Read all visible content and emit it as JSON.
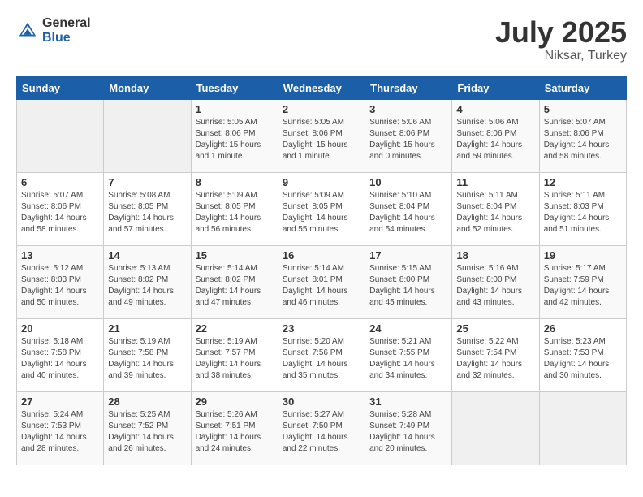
{
  "header": {
    "logo_general": "General",
    "logo_blue": "Blue",
    "month_year": "July 2025",
    "location": "Niksar, Turkey"
  },
  "days_of_week": [
    "Sunday",
    "Monday",
    "Tuesday",
    "Wednesday",
    "Thursday",
    "Friday",
    "Saturday"
  ],
  "weeks": [
    [
      {
        "day": "",
        "sunrise": "",
        "sunset": "",
        "daylight": ""
      },
      {
        "day": "",
        "sunrise": "",
        "sunset": "",
        "daylight": ""
      },
      {
        "day": "1",
        "sunrise": "Sunrise: 5:05 AM",
        "sunset": "Sunset: 8:06 PM",
        "daylight": "Daylight: 15 hours and 1 minute."
      },
      {
        "day": "2",
        "sunrise": "Sunrise: 5:05 AM",
        "sunset": "Sunset: 8:06 PM",
        "daylight": "Daylight: 15 hours and 1 minute."
      },
      {
        "day": "3",
        "sunrise": "Sunrise: 5:06 AM",
        "sunset": "Sunset: 8:06 PM",
        "daylight": "Daylight: 15 hours and 0 minutes."
      },
      {
        "day": "4",
        "sunrise": "Sunrise: 5:06 AM",
        "sunset": "Sunset: 8:06 PM",
        "daylight": "Daylight: 14 hours and 59 minutes."
      },
      {
        "day": "5",
        "sunrise": "Sunrise: 5:07 AM",
        "sunset": "Sunset: 8:06 PM",
        "daylight": "Daylight: 14 hours and 58 minutes."
      }
    ],
    [
      {
        "day": "6",
        "sunrise": "Sunrise: 5:07 AM",
        "sunset": "Sunset: 8:06 PM",
        "daylight": "Daylight: 14 hours and 58 minutes."
      },
      {
        "day": "7",
        "sunrise": "Sunrise: 5:08 AM",
        "sunset": "Sunset: 8:05 PM",
        "daylight": "Daylight: 14 hours and 57 minutes."
      },
      {
        "day": "8",
        "sunrise": "Sunrise: 5:09 AM",
        "sunset": "Sunset: 8:05 PM",
        "daylight": "Daylight: 14 hours and 56 minutes."
      },
      {
        "day": "9",
        "sunrise": "Sunrise: 5:09 AM",
        "sunset": "Sunset: 8:05 PM",
        "daylight": "Daylight: 14 hours and 55 minutes."
      },
      {
        "day": "10",
        "sunrise": "Sunrise: 5:10 AM",
        "sunset": "Sunset: 8:04 PM",
        "daylight": "Daylight: 14 hours and 54 minutes."
      },
      {
        "day": "11",
        "sunrise": "Sunrise: 5:11 AM",
        "sunset": "Sunset: 8:04 PM",
        "daylight": "Daylight: 14 hours and 52 minutes."
      },
      {
        "day": "12",
        "sunrise": "Sunrise: 5:11 AM",
        "sunset": "Sunset: 8:03 PM",
        "daylight": "Daylight: 14 hours and 51 minutes."
      }
    ],
    [
      {
        "day": "13",
        "sunrise": "Sunrise: 5:12 AM",
        "sunset": "Sunset: 8:03 PM",
        "daylight": "Daylight: 14 hours and 50 minutes."
      },
      {
        "day": "14",
        "sunrise": "Sunrise: 5:13 AM",
        "sunset": "Sunset: 8:02 PM",
        "daylight": "Daylight: 14 hours and 49 minutes."
      },
      {
        "day": "15",
        "sunrise": "Sunrise: 5:14 AM",
        "sunset": "Sunset: 8:02 PM",
        "daylight": "Daylight: 14 hours and 47 minutes."
      },
      {
        "day": "16",
        "sunrise": "Sunrise: 5:14 AM",
        "sunset": "Sunset: 8:01 PM",
        "daylight": "Daylight: 14 hours and 46 minutes."
      },
      {
        "day": "17",
        "sunrise": "Sunrise: 5:15 AM",
        "sunset": "Sunset: 8:00 PM",
        "daylight": "Daylight: 14 hours and 45 minutes."
      },
      {
        "day": "18",
        "sunrise": "Sunrise: 5:16 AM",
        "sunset": "Sunset: 8:00 PM",
        "daylight": "Daylight: 14 hours and 43 minutes."
      },
      {
        "day": "19",
        "sunrise": "Sunrise: 5:17 AM",
        "sunset": "Sunset: 7:59 PM",
        "daylight": "Daylight: 14 hours and 42 minutes."
      }
    ],
    [
      {
        "day": "20",
        "sunrise": "Sunrise: 5:18 AM",
        "sunset": "Sunset: 7:58 PM",
        "daylight": "Daylight: 14 hours and 40 minutes."
      },
      {
        "day": "21",
        "sunrise": "Sunrise: 5:19 AM",
        "sunset": "Sunset: 7:58 PM",
        "daylight": "Daylight: 14 hours and 39 minutes."
      },
      {
        "day": "22",
        "sunrise": "Sunrise: 5:19 AM",
        "sunset": "Sunset: 7:57 PM",
        "daylight": "Daylight: 14 hours and 38 minutes."
      },
      {
        "day": "23",
        "sunrise": "Sunrise: 5:20 AM",
        "sunset": "Sunset: 7:56 PM",
        "daylight": "Daylight: 14 hours and 35 minutes."
      },
      {
        "day": "24",
        "sunrise": "Sunrise: 5:21 AM",
        "sunset": "Sunset: 7:55 PM",
        "daylight": "Daylight: 14 hours and 34 minutes."
      },
      {
        "day": "25",
        "sunrise": "Sunrise: 5:22 AM",
        "sunset": "Sunset: 7:54 PM",
        "daylight": "Daylight: 14 hours and 32 minutes."
      },
      {
        "day": "26",
        "sunrise": "Sunrise: 5:23 AM",
        "sunset": "Sunset: 7:53 PM",
        "daylight": "Daylight: 14 hours and 30 minutes."
      }
    ],
    [
      {
        "day": "27",
        "sunrise": "Sunrise: 5:24 AM",
        "sunset": "Sunset: 7:53 PM",
        "daylight": "Daylight: 14 hours and 28 minutes."
      },
      {
        "day": "28",
        "sunrise": "Sunrise: 5:25 AM",
        "sunset": "Sunset: 7:52 PM",
        "daylight": "Daylight: 14 hours and 26 minutes."
      },
      {
        "day": "29",
        "sunrise": "Sunrise: 5:26 AM",
        "sunset": "Sunset: 7:51 PM",
        "daylight": "Daylight: 14 hours and 24 minutes."
      },
      {
        "day": "30",
        "sunrise": "Sunrise: 5:27 AM",
        "sunset": "Sunset: 7:50 PM",
        "daylight": "Daylight: 14 hours and 22 minutes."
      },
      {
        "day": "31",
        "sunrise": "Sunrise: 5:28 AM",
        "sunset": "Sunset: 7:49 PM",
        "daylight": "Daylight: 14 hours and 20 minutes."
      },
      {
        "day": "",
        "sunrise": "",
        "sunset": "",
        "daylight": ""
      },
      {
        "day": "",
        "sunrise": "",
        "sunset": "",
        "daylight": ""
      }
    ]
  ]
}
